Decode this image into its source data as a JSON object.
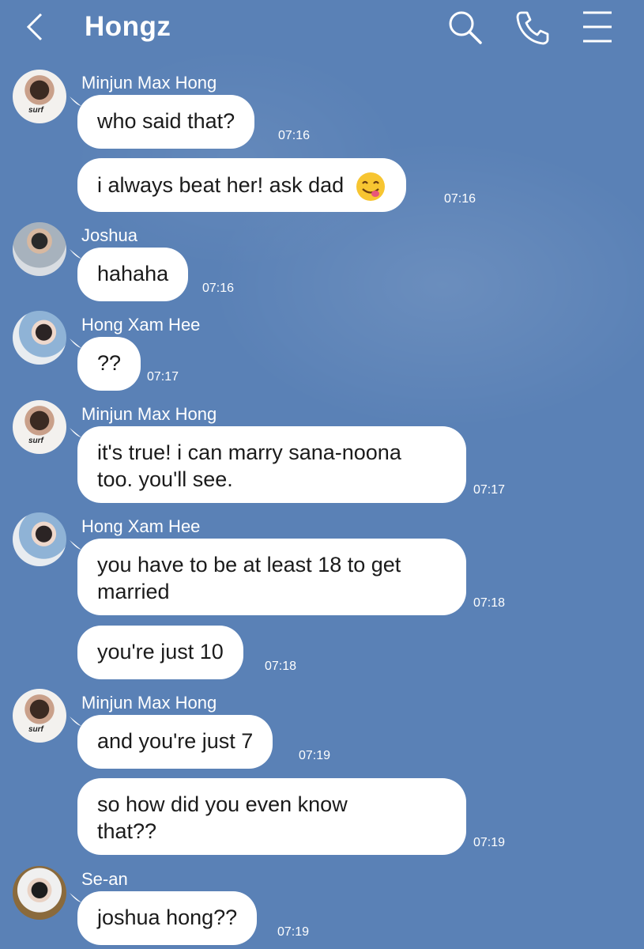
{
  "header": {
    "title": "Hongz",
    "icons": [
      "back-chevron-icon",
      "search-icon",
      "phone-icon",
      "menu-icon"
    ]
  },
  "colors": {
    "background": "#5a81b6",
    "bubble": "#ffffff",
    "header_text": "#ffffff"
  },
  "messages": [
    {
      "sender": "Minjun Max Hong",
      "text": "who said that?",
      "time": "07:16"
    },
    {
      "sender": "Minjun Max Hong",
      "text": "i always beat her! ask dad",
      "emoji": "yum-face-emoji",
      "time": "07:16"
    },
    {
      "sender": "Joshua",
      "text": "hahaha",
      "time": "07:16"
    },
    {
      "sender": "Hong Xam Hee",
      "text": "??",
      "time": "07:17"
    },
    {
      "sender": "Minjun Max Hong",
      "lines": [
        "it's true! i can marry sana-noona",
        "too. you'll see."
      ],
      "time": "07:17"
    },
    {
      "sender": "Hong Xam Hee",
      "lines": [
        "you have to be at least 18 to get",
        "married"
      ],
      "time": "07:18"
    },
    {
      "sender": "Hong Xam Hee",
      "text": "you're just 10",
      "time": "07:18"
    },
    {
      "sender": "Minjun Max Hong",
      "text": "and you're just 7",
      "time": "07:19"
    },
    {
      "sender": "Minjun Max Hong",
      "lines": [
        "so how did you even know",
        "that??"
      ],
      "time": "07:19"
    },
    {
      "sender": "Se-an",
      "text": "joshua hong??",
      "time": "07:19"
    }
  ],
  "avatar_text": {
    "minjun_shirt": "surf"
  }
}
